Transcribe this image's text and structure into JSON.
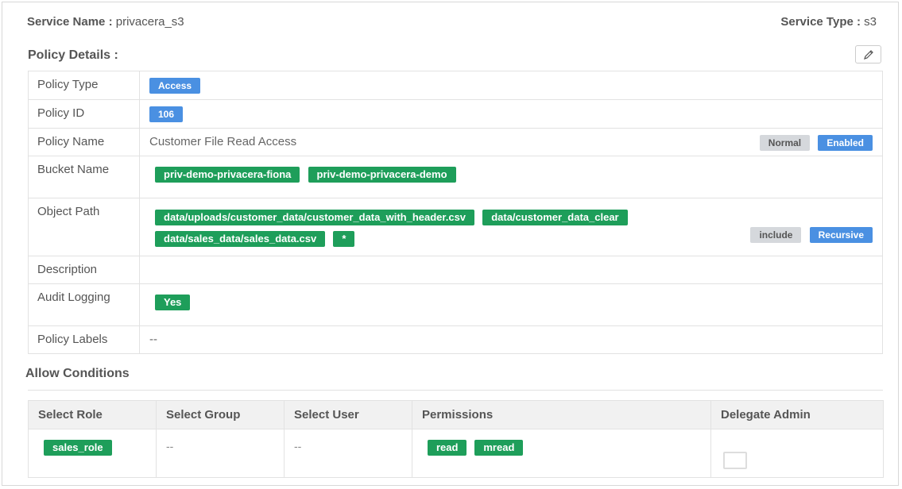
{
  "header": {
    "service_name_label": "Service Name :",
    "service_name": "privacera_s3",
    "service_type_label": "Service Type :",
    "service_type": "s3"
  },
  "policy_details": {
    "title": "Policy Details :",
    "edit_icon": "pencil-icon",
    "rows": {
      "policy_type": {
        "label": "Policy Type",
        "value": "Access"
      },
      "policy_id": {
        "label": "Policy ID",
        "value": "106"
      },
      "policy_name": {
        "label": "Policy Name",
        "value": "Customer File Read Access",
        "badge_priority": "Normal",
        "badge_status": "Enabled"
      },
      "bucket_name": {
        "label": "Bucket Name",
        "values": [
          "priv-demo-privacera-fiona",
          "priv-demo-privacera-demo"
        ]
      },
      "object_path": {
        "label": "Object Path",
        "values": [
          "data/uploads/customer_data/customer_data_with_header.csv",
          "data/customer_data_clear",
          "data/sales_data/sales_data.csv",
          "*"
        ],
        "badge_include": "include",
        "badge_recursive": "Recursive"
      },
      "description": {
        "label": "Description",
        "value": ""
      },
      "audit_logging": {
        "label": "Audit Logging",
        "value": "Yes"
      },
      "policy_labels": {
        "label": "Policy Labels",
        "value": "--"
      }
    }
  },
  "allow_conditions": {
    "title": "Allow Conditions",
    "columns": [
      "Select Role",
      "Select Group",
      "Select User",
      "Permissions",
      "Delegate Admin"
    ],
    "rows": [
      {
        "role": "sales_role",
        "group": "--",
        "user": "--",
        "permissions": [
          "read",
          "mread"
        ],
        "delegate_admin": false
      }
    ]
  },
  "colors": {
    "blue_tag": "#4a90e2",
    "green_tag": "#1e9e5a",
    "gray_tag": "#d5d8dc"
  }
}
